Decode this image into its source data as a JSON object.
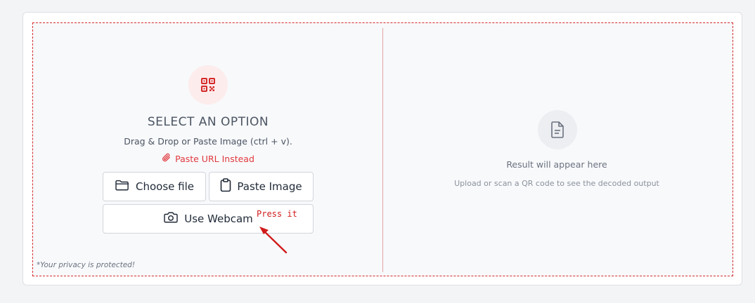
{
  "upload": {
    "title": "SELECT AN OPTION",
    "hint": "Drag & Drop or Paste Image (ctrl + v).",
    "paste_url_label": "Paste URL Instead",
    "choose_file_label": "Choose file",
    "paste_image_label": "Paste Image",
    "webcam_label": "Use Webcam",
    "privacy_note": "*Your privacy is protected!"
  },
  "annotation": {
    "text": "Press it"
  },
  "result": {
    "title": "Result will appear here",
    "subtitle": "Upload or scan a QR code to see the decoded output"
  },
  "icons": {
    "qr": "qr-code-icon",
    "paperclip": "paperclip-icon",
    "folder": "folder-icon",
    "clipboard": "clipboard-icon",
    "camera": "camera-icon",
    "document": "document-icon"
  },
  "colors": {
    "accent": "#e0393e",
    "dashed_border": "#d42a2a"
  }
}
